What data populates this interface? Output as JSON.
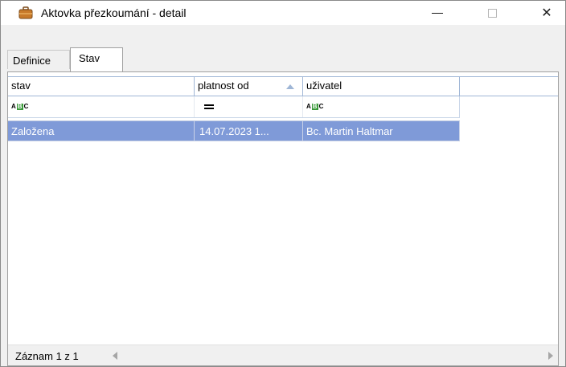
{
  "window": {
    "title": "Aktovka přezkoumání - detail",
    "icon": "briefcase-icon",
    "controls": {
      "minimize": "minimize-icon",
      "maximize": "maximize-icon",
      "close": "close-icon",
      "close_glyph": "✕"
    }
  },
  "tabs": [
    {
      "label": "Definice",
      "active": false
    },
    {
      "label": "Stav",
      "active": true
    }
  ],
  "grid": {
    "columns": [
      {
        "label": "stav"
      },
      {
        "label": "platnost od",
        "sorted": "ascending"
      },
      {
        "label": "uživatel"
      },
      {
        "label": ""
      }
    ],
    "filters": {
      "stav": {
        "icon": "text-filter-icon",
        "parts": [
          "A",
          "B",
          "C"
        ]
      },
      "platnost_od": {
        "icon": "equals-filter-icon"
      },
      "uzivatel": {
        "icon": "text-filter-icon",
        "parts": [
          "A",
          "B",
          "C"
        ]
      }
    },
    "rows": [
      {
        "stav": "Založena",
        "platnost_od": "14.07.2023 1...",
        "uzivatel": "Bc. Martin Haltmar",
        "selected": true
      }
    ],
    "colors": {
      "selected_row": "#7f9ad8",
      "header_border": "#9fb6d6"
    }
  },
  "statusbar": {
    "record_text": "Záznam 1 z 1"
  }
}
